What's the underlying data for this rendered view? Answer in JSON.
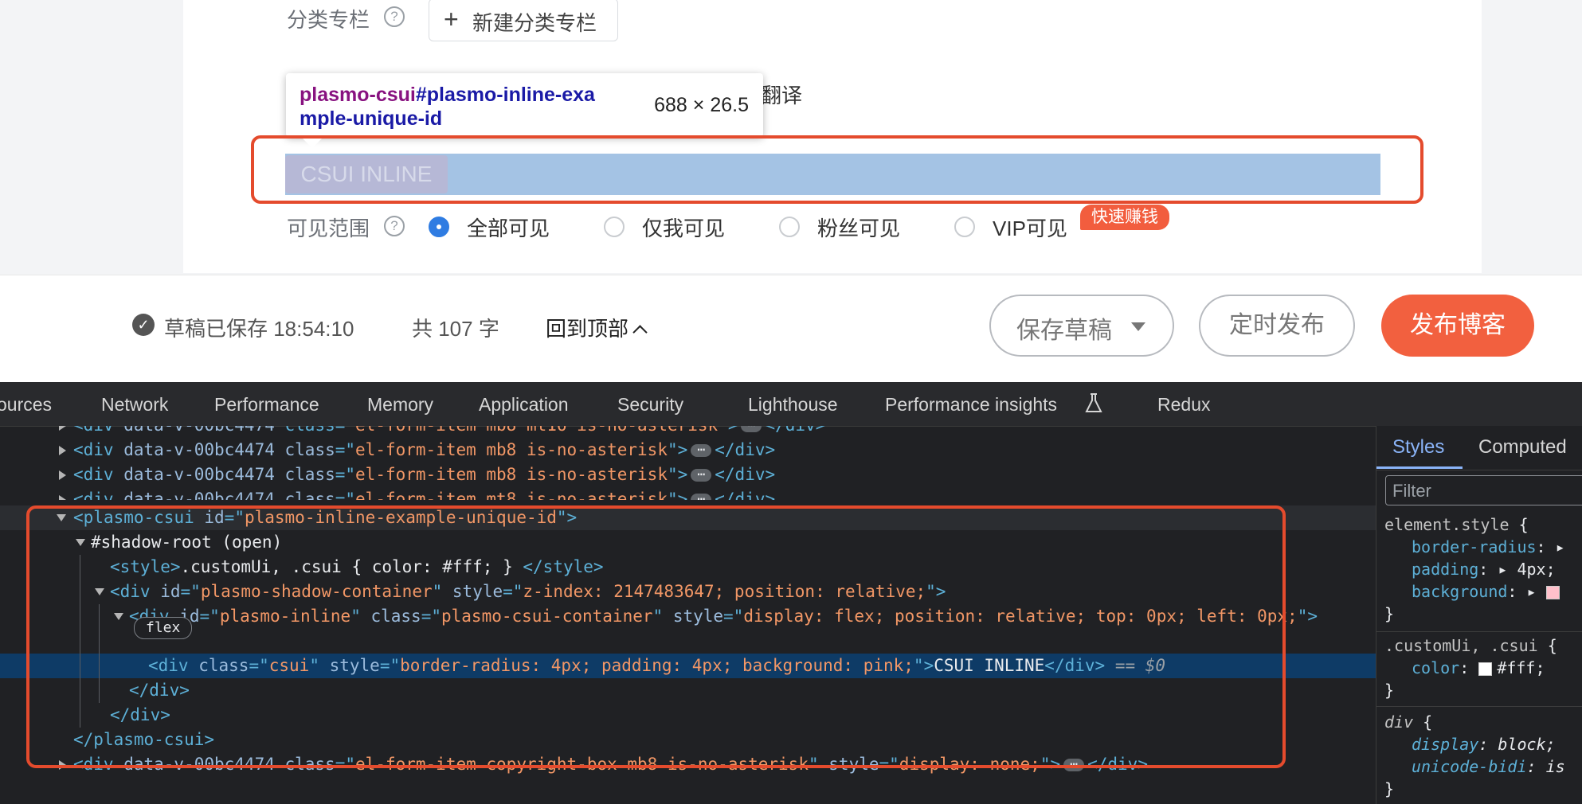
{
  "form": {
    "category_label": "分类专栏",
    "new_category_button": "新建分类专栏",
    "translate_text": "翻译",
    "inline_element_text": "CSUI INLINE",
    "visibility_label": "可见范围",
    "visibility_options": [
      "全部可见",
      "仅我可见",
      "粉丝可见",
      "VIP可见"
    ],
    "visibility_selected": "全部可见",
    "vip_badge": "快速赚钱"
  },
  "tooltip": {
    "tag": "plasmo-csui",
    "id": "#plasmo-inline-exa",
    "id_cont": "mple-unique-id",
    "dims": "688 × 26.5"
  },
  "footer": {
    "draft_status": "草稿已保存 18:54:10",
    "word_count": "共 107 字",
    "back_to_top": "回到顶部",
    "save_draft": "保存草稿",
    "schedule": "定时发布",
    "publish": "发布博客"
  },
  "devtools": {
    "tabs": [
      "ources",
      "Network",
      "Performance",
      "Memory",
      "Application",
      "Security",
      "Lighthouse",
      "Performance insights",
      "Redux"
    ],
    "elements": {
      "line0": {
        "attr": "data-v-00bc4474",
        "class": "el-form-item mb8 mt16 is-no-asterisk"
      },
      "line1": {
        "attr": "data-v-00bc4474",
        "class": "el-form-item mb8 is-no-asterisk"
      },
      "line2": {
        "attr": "data-v-00bc4474",
        "class": "el-form-item mb8 is-no-asterisk"
      },
      "line3": {
        "attr": "data-v-00bc4474",
        "class": "el-form-item mt8 is-no-asterisk"
      },
      "csui_tag": "plasmo-csui",
      "csui_id": "plasmo-inline-example-unique-id",
      "shadow_root": "#shadow-root (open)",
      "style_content": ".customUi, .csui { color: #fff; }",
      "shadow_container_id": "plasmo-shadow-container",
      "shadow_container_style": "z-index: 2147483647; position: relative;",
      "inline_id": "plasmo-inline",
      "inline_class": "plasmo-csui-container",
      "inline_style": "display: flex; position: relative; top: 0px; left: 0px;",
      "flex_badge": "flex",
      "csui_class": "csui",
      "csui_style": "border-radius: 4px; padding: 4px; background: pink;",
      "csui_text": "CSUI INLINE",
      "selected_marker": "== $0",
      "copyright_class": "el-form-item copyright-box mb8 is-no-asterisk",
      "copyright_style": "display: none;"
    },
    "styles": {
      "tab_styles": "Styles",
      "tab_computed": "Computed",
      "filter_placeholder": "Filter",
      "element_style_selector": "element.style",
      "es_prop1": "border-radius",
      "es_prop2": "padding",
      "es_val2": "4px",
      "es_prop3": "background",
      "custom_selector": ".customUi, .csui",
      "custom_prop": "color",
      "custom_val": "#fff",
      "div_selector": "div",
      "div_prop1": "display",
      "div_val1": "block",
      "div_prop2": "unicode-bidi",
      "div_val2": "is"
    }
  },
  "colors": {
    "accent": "#f2603f",
    "callout": "#e44b2d",
    "radio_active": "#2f7ce2",
    "highlight": "#a4c3e4"
  }
}
